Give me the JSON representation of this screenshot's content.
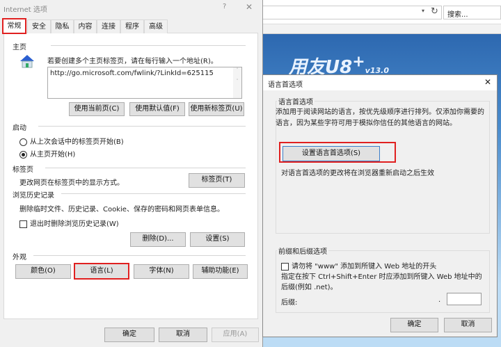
{
  "browser": {
    "search_placeholder": "搜索...",
    "logo_text": "用友U8",
    "logo_plus": "+",
    "logo_version": "v13.0"
  },
  "inet": {
    "title": "Internet 选项",
    "help": "?",
    "close": "✕",
    "tabs": [
      "常规",
      "安全",
      "隐私",
      "内容",
      "连接",
      "程序",
      "高级"
    ],
    "home": {
      "heading": "主页",
      "hint": "若要创建多个主页标签页，请在每行输入一个地址(R)。",
      "url": "http://go.microsoft.com/fwlink/?LinkId=625115",
      "use_current": "使用当前页(C)",
      "use_default": "使用默认值(F)",
      "use_new_tab": "使用新标签页(U)"
    },
    "startup": {
      "heading": "启动",
      "opt1": "从上次会话中的标签页开始(B)",
      "opt2": "从主页开始(H)"
    },
    "tabs_section": {
      "heading": "标签页",
      "text": "更改网页在标签页中的显示方式。",
      "button": "标签页(T)"
    },
    "history": {
      "heading": "浏览历史记录",
      "text": "删除临时文件、历史记录、Cookie、保存的密码和网页表单信息。",
      "checkbox": "退出时删除浏览历史记录(W)",
      "delete": "删除(D)...",
      "settings": "设置(S)"
    },
    "appearance": {
      "heading": "外观",
      "colors": "颜色(O)",
      "languages": "语言(L)",
      "fonts": "字体(N)",
      "accessibility": "辅助功能(E)"
    },
    "ok": "确定",
    "cancel": "取消",
    "apply": "应用(A)"
  },
  "lang": {
    "title": "语言首选项",
    "close": "✕",
    "group1": "语言首选项",
    "desc": "添加用于阅读网站的语言，按优先级顺序进行排列。仅添加你需要的语言，因为某些字符可用于模拟你信任的其他语言的网站。",
    "set_button": "设置语言首选项(S)",
    "note": "对语言首选项的更改将在浏览器重新启动之后生效",
    "group2": "前缀和后缀选项",
    "www_checkbox": "请勿将 \"www\" 添加到所键入 Web 地址的开头",
    "suffix_desc": "指定在按下 Ctrl+Shift+Enter 时应添加到所键入 Web 地址中的后缀(例如 .net)。",
    "suffix_label": "后缀:",
    "dot": ".",
    "suffix_value": "",
    "ok": "确定",
    "cancel": "取消"
  },
  "colors": {
    "highlight": "#e02020",
    "banner": "#3a78bd"
  }
}
